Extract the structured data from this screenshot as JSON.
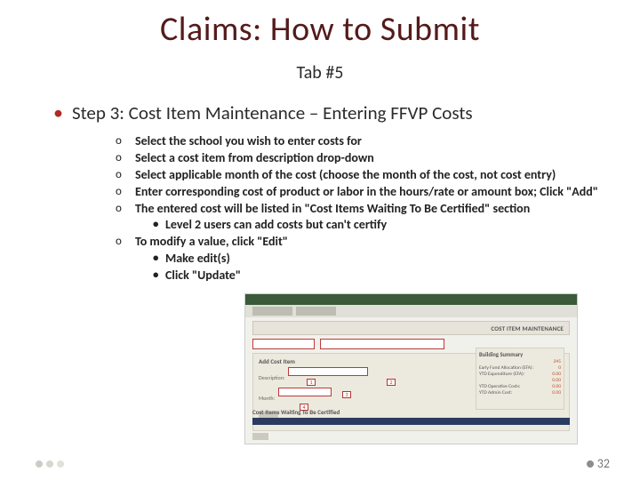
{
  "title": "Claims: How to Submit",
  "subtitle": "Tab #5",
  "step": "Step 3: Cost Item Maintenance – Entering FFVP Costs",
  "items": [
    "Select the school you wish to enter costs for",
    "Select a cost item from description drop-down",
    "Select applicable month of the cost (choose the month of the cost, not cost entry)",
    "Enter corresponding cost of product or labor in the hours/rate or amount box; Click \"Add\"",
    "The entered cost will be listed in \"Cost Items Waiting To Be Certified\" section",
    "To modify a value, click \"Edit\""
  ],
  "sub5": "Level 2 users can add costs but can't certify",
  "sub6a": "Make edit(s)",
  "sub6b": "Click \"Update\"",
  "screenshot": {
    "header_right": "COST ITEM MAINTENANCE",
    "addbox_title": "Add Cost Item",
    "lbl_desc": "Description:",
    "lbl_month": "Month:",
    "summary_title": "Building Summary",
    "summary_rows": [
      {
        "k": "",
        "v": "245"
      },
      {
        "k": "Early Fund Allocation (EFA):",
        "v": "0"
      },
      {
        "k": "YTD Expenditure (EFA):",
        "v": "0.00"
      },
      {
        "k": "",
        "v": "0.00"
      },
      {
        "k": "YTD Operative Costs:",
        "v": "0.00"
      },
      {
        "k": "YTD Admin Cost:",
        "v": "0.00"
      }
    ],
    "cert_title": "Cost Items Waiting To Be Certified"
  },
  "page": "32"
}
